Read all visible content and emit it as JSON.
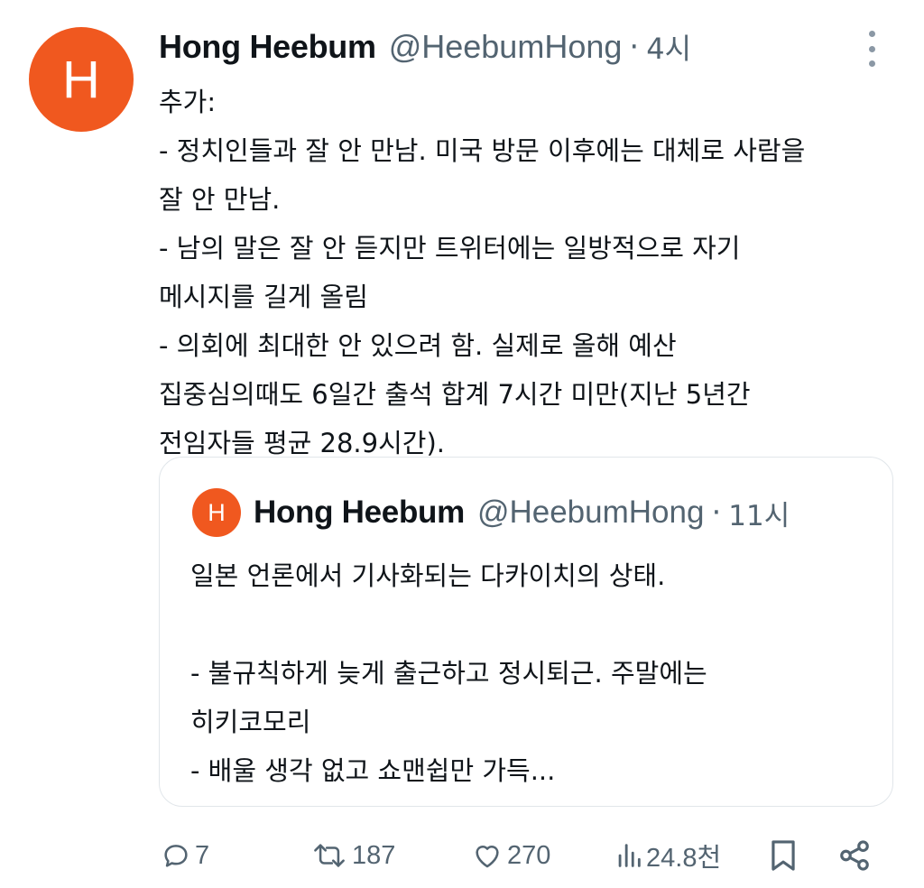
{
  "tweet": {
    "avatar_letter": "H",
    "author_name": "Hong Heebum",
    "author_handle": "@HeebumHong",
    "separator": "·",
    "time": "4시",
    "text_lines": [
      "추가:",
      "- 정치인들과 잘 안 만남. 미국 방문 이후에는 대체로 사람을",
      "잘 안 만남.",
      "- 남의 말은 잘 안 듣지만 트위터에는 일방적으로 자기",
      "메시지를 길게 올림",
      "- 의회에 최대한 안 있으려 함. 실제로 올해 예산",
      "집중심의때도 6일간 출석 합계 7시간 미만(지난 5년간",
      "전임자들 평균 28.9시간)."
    ]
  },
  "quote": {
    "avatar_letter": "H",
    "author_name": "Hong Heebum",
    "author_handle": "@HeebumHong",
    "separator": "·",
    "time": "11시",
    "text_lines": [
      "일본 언론에서 기사화되는 다카이치의 상태.",
      "",
      "- 불규칙하게 늦게 출근하고 정시퇴근. 주말에는",
      "히키코모리",
      "- 배울 생각 없고 쇼맨쉽만 가득..."
    ]
  },
  "actions": {
    "reply": {
      "icon": "reply-icon",
      "count": "7"
    },
    "retweet": {
      "icon": "retweet-icon",
      "count": "187"
    },
    "like": {
      "icon": "heart-icon",
      "count": "270"
    },
    "views": {
      "icon": "views-icon",
      "count": "24.8천"
    },
    "bookmark": {
      "icon": "bookmark-icon"
    },
    "share": {
      "icon": "share-icon"
    }
  },
  "colors": {
    "avatar_bg": "#f0581f",
    "text": "#0f1419",
    "secondary": "#536471",
    "border": "#e1e6ea"
  }
}
